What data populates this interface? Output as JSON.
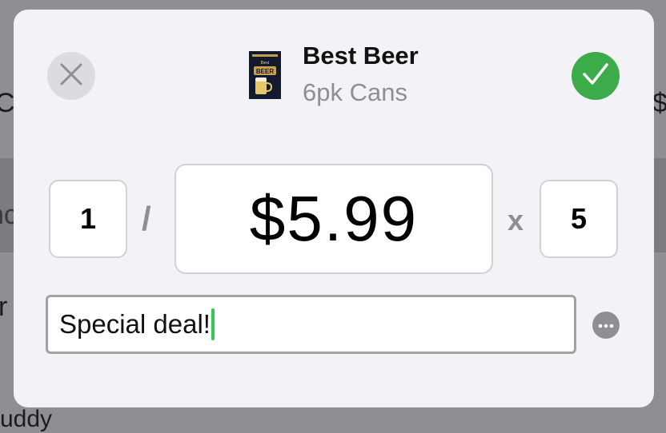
{
  "background": {
    "left_fragment_1": "Ca",
    "left_fragment_2": "nc",
    "left_fragment_3": "r",
    "right_fragment": "$",
    "bottom_fragment": "uddy"
  },
  "header": {
    "product_name": "Best Beer",
    "product_subtitle": "6pk Cans",
    "thumbnail_label_top": "Best",
    "thumbnail_label_main": "BEER"
  },
  "pricing": {
    "quantity": "1",
    "separator": "/",
    "price": "$5.99",
    "times_symbol": "x",
    "multiplier": "5"
  },
  "note": {
    "value": "Special deal!"
  },
  "colors": {
    "confirm": "#3cab4a",
    "caret": "#34c759",
    "modal_bg": "#f2f2f7"
  },
  "icons": {
    "close": "close-icon",
    "confirm": "checkmark-icon",
    "more": "ellipsis-icon"
  }
}
